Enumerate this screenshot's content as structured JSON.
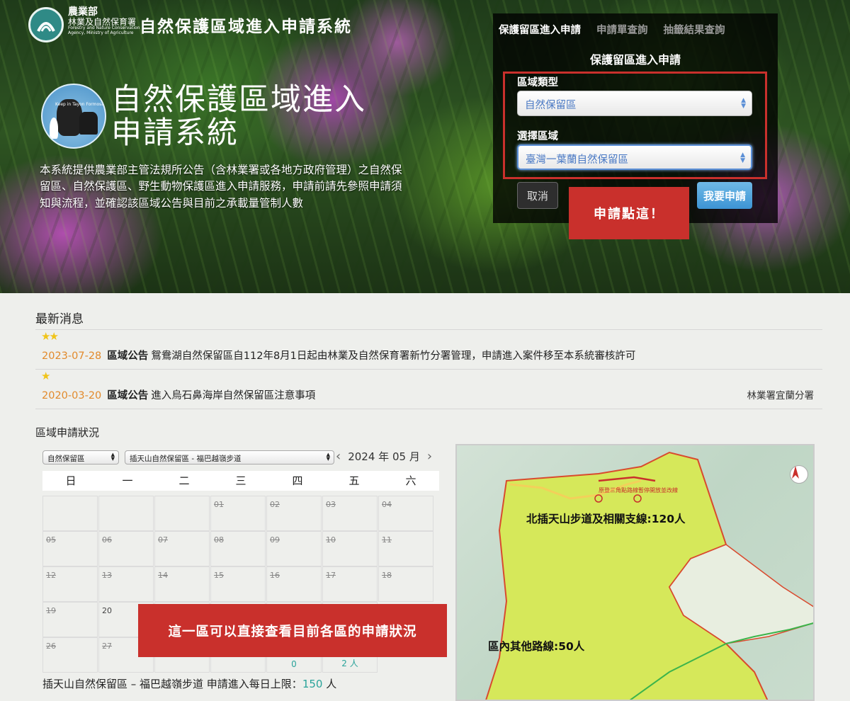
{
  "header": {
    "agency_line1": "農業部",
    "agency_line2": "林業及自然保育署",
    "agency_line3": "Forestry and Nature Conservation Agency, Ministry of Agriculture",
    "system_title": "自然保護區域進入申請系統",
    "emblem_text": "Keep in Tayon Formosa",
    "big_title_line1": "自然保護區域進入",
    "big_title_line2": "申請系統",
    "intro": "本系統提供農業部主管法規所公告（含林業署或各地方政府管理）之自然保留區、自然保護區、野生動物保護區進入申請服務，申請前請先參照申請須知與流程，並確認該區域公告與目前之承載量管制人數"
  },
  "panel": {
    "tabs": [
      "保護留區進入申請",
      "申請單查詢",
      "抽籤結果查詢"
    ],
    "heading": "保護留區進入申請",
    "region_type_label": "區域類型",
    "region_type_value": "自然保留區",
    "region_label": "選擇區域",
    "region_value": "臺灣一葉蘭自然保留區",
    "cancel_label": "取消",
    "apply_label": "我要申請",
    "callout": "申請點這！"
  },
  "news": {
    "title": "最新消息",
    "items": [
      {
        "stars": "★★",
        "date": "2023-07-28",
        "category": "區域公告",
        "text": "鴛鴦湖自然保留區自112年8月1日起由林業及自然保育署新竹分署管理，申請進入案件移至本系統審核許可",
        "org": ""
      },
      {
        "stars": "★",
        "date": "2020-03-20",
        "category": "區域公告",
        "text": "進入烏石鼻海岸自然保留區注意事項",
        "org": "林業署宜蘭分署"
      }
    ]
  },
  "status": {
    "title": "區域申請狀況",
    "type_select": "自然保留區",
    "area_select": "插天山自然保留區 - 福巴越嶺步道",
    "year": "2024",
    "year_unit": "年",
    "month": "05",
    "month_unit": "月",
    "weekdays": [
      "日",
      "一",
      "二",
      "三",
      "四",
      "五",
      "六"
    ],
    "days": [
      [
        "",
        "",
        "",
        "01",
        "02",
        "03",
        "04"
      ],
      [
        "05",
        "06",
        "07",
        "08",
        "09",
        "10",
        "11"
      ],
      [
        "12",
        "13",
        "14",
        "15",
        "16",
        "17",
        "18"
      ],
      [
        "19",
        "20",
        "",
        "",
        "",
        "",
        ""
      ],
      [
        "26",
        "27",
        "",
        "",
        "",
        "",
        ""
      ]
    ],
    "counts": {
      "30": "0",
      "31": "2 人"
    },
    "callout": "這一區可以直接查看目前各區的申請狀況",
    "limit_prefix": "插天山自然保留區 – 福巴越嶺步道 申請進入每日上限：",
    "limit_value": "150",
    "limit_unit": "人"
  },
  "map": {
    "label_north": "北插天山步道及相關支線:120人",
    "label_other": "區內其他路線:50人",
    "note": "原登三角點路線暫停開放並改線"
  },
  "colors": {
    "accent_red": "#c9302c",
    "date_orange": "#e28a2c",
    "teal": "#2aa39a",
    "apply_blue": "#3d94d4"
  }
}
